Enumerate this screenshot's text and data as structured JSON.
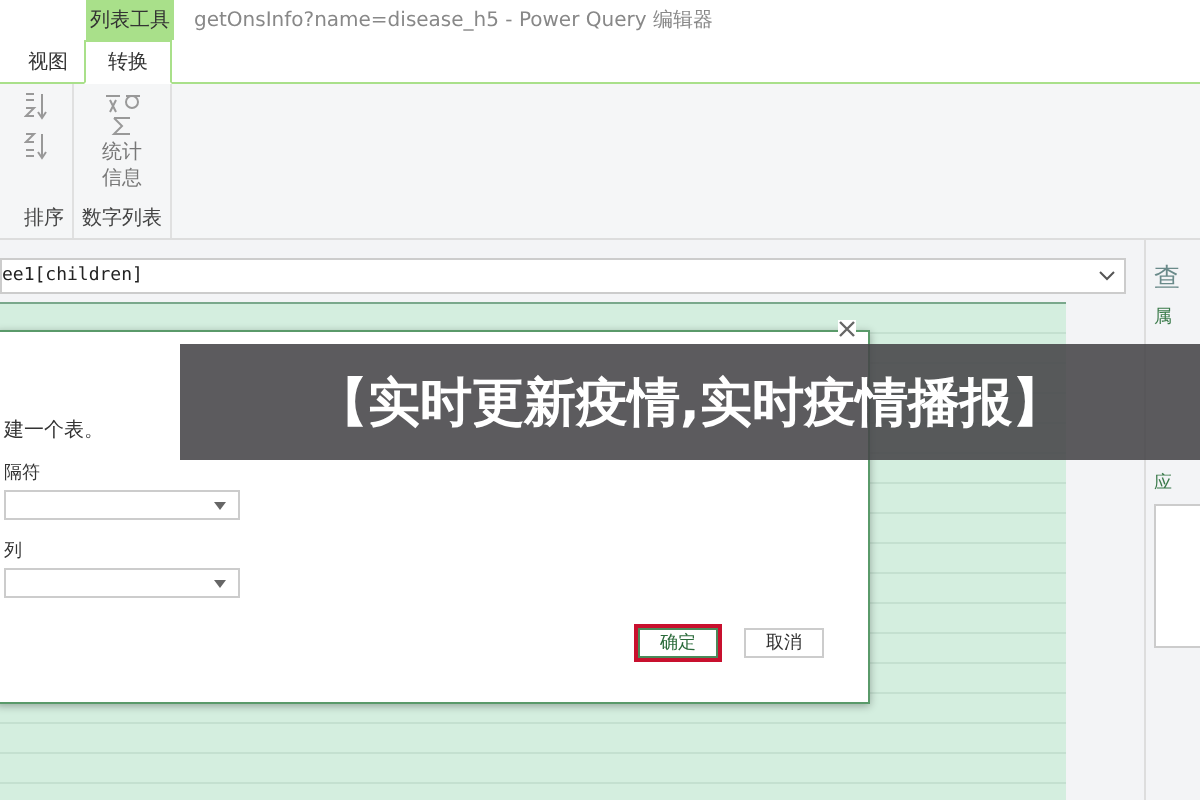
{
  "window": {
    "context_tab": "列表工具",
    "title": "getOnsInfo?name=disease_h5 - Power Query 编辑器"
  },
  "tabs": [
    {
      "label": "视图",
      "selected": false
    },
    {
      "label": "转换",
      "selected": true
    }
  ],
  "ribbon": {
    "groups": [
      {
        "label": "排序",
        "kind": "sort"
      },
      {
        "label": "数字列表",
        "kind": "stats",
        "button": [
          "统计",
          "信息"
        ]
      }
    ]
  },
  "formula_bar": {
    "value": "ee1[children]"
  },
  "dialog": {
    "description": "建一个表。",
    "fields": [
      {
        "label": "隔符"
      },
      {
        "label": "列"
      }
    ],
    "buttons": [
      {
        "label": "确定",
        "selected": true
      },
      {
        "label": "取消",
        "selected": false
      }
    ]
  },
  "query_panel": {
    "title": "查",
    "sections": [
      {
        "label": "属"
      },
      {
        "label": "应"
      }
    ]
  },
  "banner": {
    "text": "【实时更新疫情,实时疫情播报】"
  }
}
